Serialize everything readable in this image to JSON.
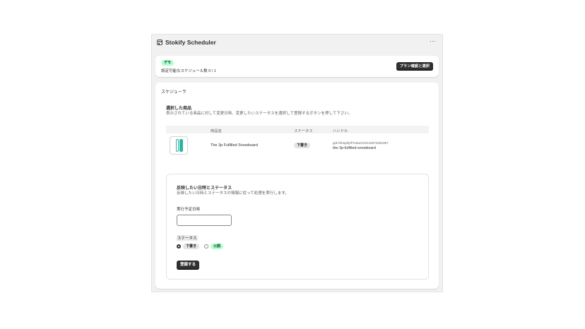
{
  "app": {
    "title": "Stokify Scheduler",
    "more_icon": "more-horizontal-icon",
    "more_glyph": "···"
  },
  "plan": {
    "badge": "デモ",
    "schedule_count_text": "設定可能なスケジュール数 0 / 1",
    "button_label": "プラン確認と選択"
  },
  "scheduler": {
    "title": "スケジューラ",
    "selected_title": "選択した商品",
    "selected_desc": "表示されている商品に対して変更日時、変更したいステータスを選択して登録するボタンを押して下さい。",
    "table": {
      "headers": [
        "商品名",
        "ステータス",
        "ハンドル"
      ],
      "rows": [
        {
          "name": "The 3p Fulfilled Snowboard",
          "status": "下書き",
          "gid": "gid://shopify/Product/10144674251067",
          "handle": "the-3p-fulfilled-snowboard"
        }
      ]
    },
    "form": {
      "title": "反映したい日時とステータス",
      "desc": "反映したい日時とステータスの情報に従って処理を実行します。",
      "date_label": "実行予定日時",
      "date_value": "",
      "status_label": "ステータス",
      "options": [
        "下書き",
        "公開"
      ],
      "selected_option": "下書き",
      "submit_label": "登録する"
    }
  },
  "colors": {
    "primary_button": "#303030",
    "success_badge": "#b4fed2",
    "neutral_badge": "#e3e3e3",
    "background": "#f1f1f1"
  }
}
